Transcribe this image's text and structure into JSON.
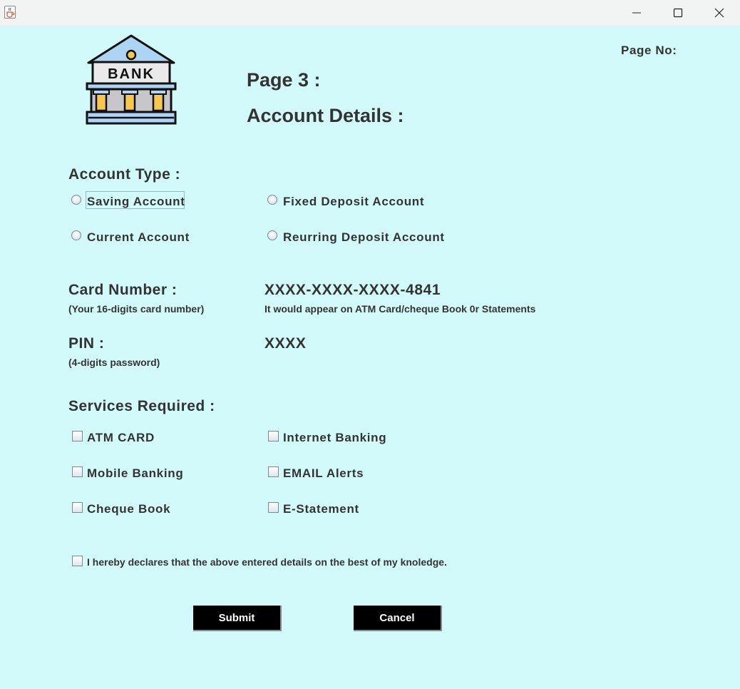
{
  "window": {
    "app_icon": "java-cup-icon",
    "buttons": [
      "minimize-icon",
      "maximize-icon",
      "close-icon"
    ]
  },
  "header": {
    "logo_text": "BANK",
    "page_no_label": "Page No:",
    "page_title": "Page 3 :",
    "section_title": "Account Details :"
  },
  "account_type": {
    "label": "Account Type :",
    "options": [
      "Saving Account",
      "Fixed Deposit Account",
      "Current Account",
      "Reurring Deposit Account"
    ],
    "focused": "Saving Account"
  },
  "card": {
    "label": "Card Number :",
    "hint": "(Your 16-digits card number)",
    "value": "XXXX-XXXX-XXXX-4841",
    "note": "It would appear on ATM Card/cheque Book 0r Statements"
  },
  "pin": {
    "label": "PIN :",
    "hint": "(4-digits password)",
    "value": "XXXX"
  },
  "services": {
    "label": "Services Required :",
    "options": [
      "ATM CARD",
      "Internet Banking",
      "Mobile Banking",
      "EMAIL Alerts",
      "Cheque Book",
      "E-Statement"
    ]
  },
  "declaration": "I hereby declares that the above entered details on the best of my knoledge.",
  "buttons": {
    "submit": "Submit",
    "cancel": "Cancel"
  },
  "colors": {
    "background": "#d3fafb",
    "button_bg": "#000000",
    "button_text": "#ffffff",
    "text": "#333333"
  }
}
